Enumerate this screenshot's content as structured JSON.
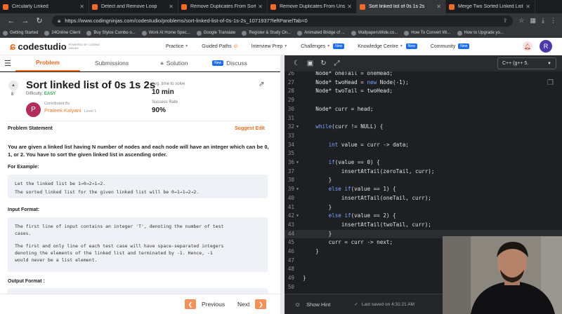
{
  "browser": {
    "tabs": [
      {
        "label": "Circularly Linked"
      },
      {
        "label": "Detect and Remove Loop"
      },
      {
        "label": "Remove Duplicates From Sorted"
      },
      {
        "label": "Remove Duplicates From Unsort"
      },
      {
        "label": "Sort linked list of 0s 1s 2s"
      },
      {
        "label": "Merge Two Sorted Linked Lists"
      }
    ],
    "url": "https://www.codingninjas.com/codestudio/problems/sort-linked-list-of-0s-1s-2s_1071937?leftPanelTab=0",
    "bookmarks": [
      "Getting Started",
      "24Online Client",
      "Buy Stylox Combo o...",
      "Work At Home Spec...",
      "Google Translate",
      "Register & Study On...",
      "Animated Bridge of ...",
      "WallpapersWide.co...",
      "How To Convert Wi...",
      "How to Upgrade yo..."
    ]
  },
  "site": {
    "logo_text": "codestudio",
    "logo_sub": "POWERED BY CODING NINJAS",
    "nav": [
      "Practice",
      "Guided Paths",
      "Interview Prep",
      "Challenges",
      "Knowledge Centre",
      "Community"
    ],
    "new_badge": "New",
    "user_initial": "R"
  },
  "left_tabs": {
    "problem": "Problem",
    "submissions": "Submissions",
    "solution": "Solution",
    "discuss": "Discuss",
    "discuss_badge": "New"
  },
  "problem": {
    "votes": "8",
    "title": "Sort linked list of 0s 1s 2s",
    "difficulty_label": "Difficulty:",
    "difficulty": "EASY",
    "contributed_by": "Contributed By",
    "author_initial": "P",
    "author": "Prateek Kalyani",
    "level": "Level 1",
    "avg_time_label": "Avg. time to solve",
    "avg_time": "10 min",
    "success_label": "Success Rate",
    "success": "90%",
    "statement_label": "Problem Statement",
    "suggest_edit": "Suggest Edit",
    "description": "You are given a linked list having N number of nodes and each node will have an integer which can be 0, 1, or 2. You have to sort the given linked list in ascending order.",
    "example_label": "For Example:",
    "example_line1": "Let the linked list be 1→0→2→1→2.",
    "example_line2": "The sorted linked list for the given linked list will be 0→1→1→2→2.",
    "input_label": "Input Format:",
    "input_line1": "The first line of input contains an integer 'T', denoting the number of test",
    "input_line2": "cases.",
    "input_line3": "The first and only line of each test case will have space-separated integers",
    "input_line4": "denoting the elements of the linked list and terminated by -1. Hence, -1",
    "input_line5": "would never be a list element.",
    "output_label": "Output Format :"
  },
  "footer": {
    "previous": "Previous",
    "next": "Next",
    "show_hint": "Show Hint",
    "last_saved": "Last saved on 4:31:21 AM"
  },
  "editor": {
    "language": "C++ (g++ 5.",
    "lines": [
      {
        "n": "26",
        "code": "    Node* oneTail = oneHead;"
      },
      {
        "n": "27",
        "code": "    Node* twoHead = new Node(-1);"
      },
      {
        "n": "28",
        "code": "    Node* twoTail = twoHead;"
      },
      {
        "n": "29",
        "code": ""
      },
      {
        "n": "30",
        "code": "    Node* curr = head;"
      },
      {
        "n": "31",
        "code": ""
      },
      {
        "n": "32",
        "code": "    while(curr != NULL) {"
      },
      {
        "n": "33",
        "code": ""
      },
      {
        "n": "34",
        "code": "        int value = curr -> data;"
      },
      {
        "n": "35",
        "code": ""
      },
      {
        "n": "36",
        "code": "        if(value == 0) {"
      },
      {
        "n": "37",
        "code": "            insertAtTail(zeroTail, curr);"
      },
      {
        "n": "38",
        "code": "        }"
      },
      {
        "n": "39",
        "code": "        else if(value == 1) {"
      },
      {
        "n": "40",
        "code": "            insertAtTail(oneTail, curr);"
      },
      {
        "n": "41",
        "code": "        }"
      },
      {
        "n": "42",
        "code": "        else if(value == 2) {"
      },
      {
        "n": "43",
        "code": "            insertAtTail(twoTail, curr);"
      },
      {
        "n": "44",
        "code": "        }"
      },
      {
        "n": "45",
        "code": "        curr = curr -> next;"
      },
      {
        "n": "46",
        "code": "    }"
      },
      {
        "n": "47",
        "code": ""
      },
      {
        "n": "48",
        "code": ""
      },
      {
        "n": "49",
        "code": "}"
      },
      {
        "n": "50",
        "code": ""
      }
    ]
  }
}
